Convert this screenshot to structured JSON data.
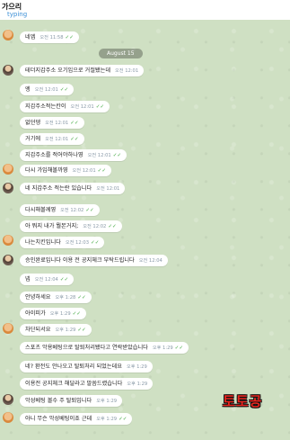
{
  "header": {
    "title": "가으리",
    "status": "typing"
  },
  "date_separator": "August 15",
  "messages": [
    {
      "text": "네엡",
      "time": "오전 11:58",
      "ticks": "✓✓"
    },
    {
      "text": "테더지갑주소 오기입으로 거절됐는데",
      "time": "오전 12:01",
      "ticks": ""
    },
    {
      "text": "엥",
      "time": "오전 12:01",
      "ticks": "✓✓"
    },
    {
      "text": "지갑주소적는칸이",
      "time": "오전 12:01",
      "ticks": "✓✓"
    },
    {
      "text": "없던뎅",
      "time": "오전 12:01",
      "ticks": "✓✓"
    },
    {
      "text": "거기에",
      "time": "오전 12:01",
      "ticks": "✓✓"
    },
    {
      "text": "지갑주소를 적어야하나영",
      "time": "오전 12:01",
      "ticks": "✓✓"
    },
    {
      "text": "다시 가입해볼까영",
      "time": "오전 12:01",
      "ticks": "✓✓"
    },
    {
      "text": "네 지갑주소 적는란 있습니다",
      "time": "오전 12:01",
      "ticks": ""
    },
    {
      "text": "다시해볼께영",
      "time": "오전 12:02",
      "ticks": "✓✓"
    },
    {
      "text": "아 뭐지 내가 뭘본거지;",
      "time": "오전 12:02",
      "ticks": "✓✓"
    },
    {
      "text": "나는치킨입니다",
      "time": "오전 12:03",
      "ticks": "✓✓"
    },
    {
      "text": "승인완료입니다 이용 전 공지체크 부탁드립니다",
      "time": "오전 12:04",
      "ticks": ""
    },
    {
      "text": "넵",
      "time": "오전 12:04",
      "ticks": "✓✓"
    },
    {
      "text": "안녕하세요",
      "time": "오후 1:28",
      "ticks": "✓✓"
    },
    {
      "text": "아이피가",
      "time": "오후 1:29",
      "ticks": "✓✓"
    },
    {
      "text": "차단되서요",
      "time": "오후 1:29",
      "ticks": "✓✓"
    },
    {
      "text": "스포츠 악용베팅으로 탈퇴처리됐다고 연락받았습니다",
      "time": "오후 1:29",
      "ticks": "✓✓"
    },
    {
      "text": "네? 환전도 안나오고 탈퇴처리 되었는데요",
      "time": "오후 1:29",
      "ticks": ""
    },
    {
      "text": "이용전 공지체크 해달라고 말씀드렸습니다",
      "time": "오후 1:29",
      "ticks": ""
    },
    {
      "text": "악성베팅 볼수 주 탈퇴입니다",
      "time": "오후 1:29",
      "ticks": ""
    },
    {
      "text": "아니 무슨 악성베팅이죠 근데",
      "time": "오후 1:29",
      "ticks": "✓✓"
    }
  ],
  "watermark": "토토공"
}
